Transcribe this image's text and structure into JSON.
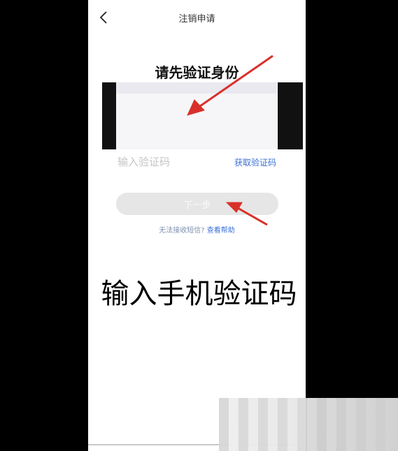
{
  "header": {
    "title": "注销申请"
  },
  "verify": {
    "heading": "请先验证身份",
    "code_placeholder": "输入验证码",
    "get_code_label": "获取验证码",
    "next_label": "下一步",
    "help_text": "无法接收短信?",
    "help_link": "查看帮助"
  },
  "annotation": {
    "caption": "输入手机验证码",
    "arrow_color": "#d9302a"
  },
  "colors": {
    "link": "#3a6fd8",
    "button_disabled": "#e6e6e6"
  }
}
